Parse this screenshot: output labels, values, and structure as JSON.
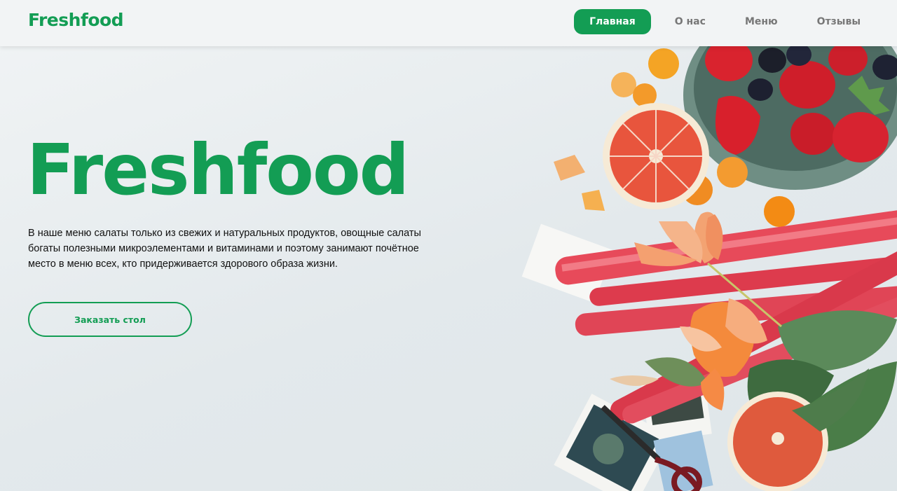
{
  "header": {
    "logo": "Freshfood",
    "nav": [
      {
        "label": "Главная",
        "active": true
      },
      {
        "label": "О нас",
        "active": false
      },
      {
        "label": "Меню",
        "active": false
      },
      {
        "label": "Отзывы",
        "active": false
      }
    ]
  },
  "hero": {
    "title": "Freshfood",
    "description": "В наше меню салаты только из свежих и натуральных продуктов, овощные салаты богаты полезными микроэлементами и витаминами и поэтому занимают почётное место в меню всех, кто придерживается здорового образа жизни.",
    "cta_label": "Заказать стол",
    "image": "fresh-food-photo"
  },
  "colors": {
    "brand_green": "#139d54",
    "background": "#e9eef0",
    "header_bg": "#f2f4f5"
  }
}
